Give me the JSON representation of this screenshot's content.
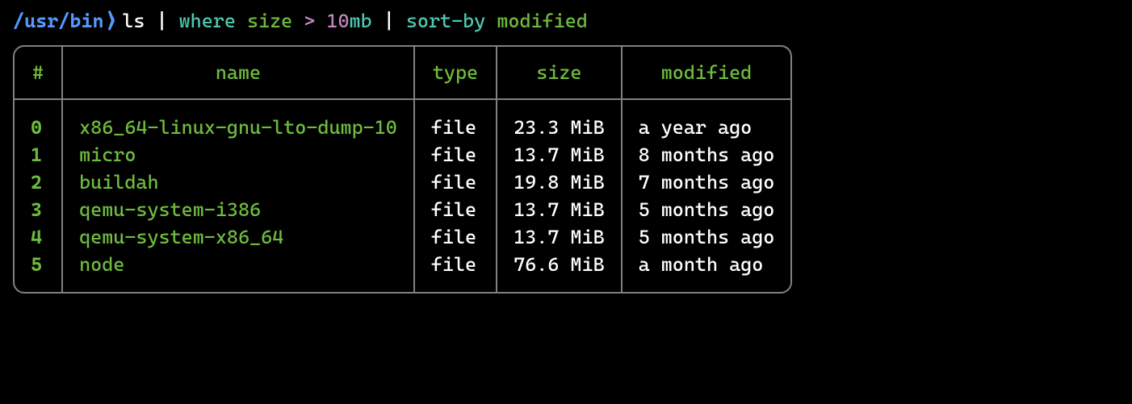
{
  "prompt": {
    "path": "/usr/bin",
    "separator": "⟩",
    "command_parts": [
      {
        "text": "ls",
        "cls": "cmd-white"
      },
      {
        "text": " ",
        "cls": "cmd-white"
      },
      {
        "text": "|",
        "cls": "cmd-pipe"
      },
      {
        "text": " ",
        "cls": "cmd-white"
      },
      {
        "text": "where",
        "cls": "cmd-cyan"
      },
      {
        "text": " ",
        "cls": "cmd-white"
      },
      {
        "text": "size",
        "cls": "cmd-green"
      },
      {
        "text": " ",
        "cls": "cmd-white"
      },
      {
        "text": ">",
        "cls": "cmd-purple"
      },
      {
        "text": " ",
        "cls": "cmd-white"
      },
      {
        "text": "10",
        "cls": "cmd-purple"
      },
      {
        "text": "mb",
        "cls": "cmd-cyan"
      },
      {
        "text": " ",
        "cls": "cmd-white"
      },
      {
        "text": "|",
        "cls": "cmd-pipe"
      },
      {
        "text": " ",
        "cls": "cmd-white"
      },
      {
        "text": "sort-by",
        "cls": "cmd-cyan"
      },
      {
        "text": " ",
        "cls": "cmd-white"
      },
      {
        "text": "modified",
        "cls": "cmd-green"
      }
    ]
  },
  "table": {
    "headers": [
      "#",
      "name",
      "type",
      "size",
      "modified"
    ],
    "rows": [
      {
        "idx": "0",
        "name": "x86_64-linux-gnu-lto-dump-10",
        "type": "file",
        "size": "23.3 MiB",
        "modified": "a year ago"
      },
      {
        "idx": "1",
        "name": "micro",
        "type": "file",
        "size": "13.7 MiB",
        "modified": "8 months ago"
      },
      {
        "idx": "2",
        "name": "buildah",
        "type": "file",
        "size": "19.8 MiB",
        "modified": "7 months ago"
      },
      {
        "idx": "3",
        "name": "qemu-system-i386",
        "type": "file",
        "size": "13.7 MiB",
        "modified": "5 months ago"
      },
      {
        "idx": "4",
        "name": "qemu-system-x86_64",
        "type": "file",
        "size": "13.7 MiB",
        "modified": "5 months ago"
      },
      {
        "idx": "5",
        "name": "node",
        "type": "file",
        "size": "76.6 MiB",
        "modified": "a month ago"
      }
    ]
  }
}
